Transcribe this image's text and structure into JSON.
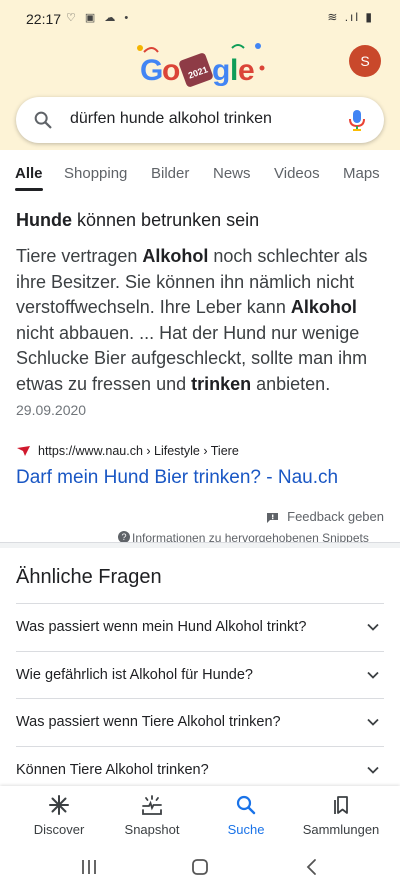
{
  "status_bar": {
    "time": "22:17",
    "left_icons": "♡ ▣ ☁ •",
    "right_icons": "≋ .ıl ▮"
  },
  "header": {
    "doodle_label": "Google",
    "doodle_year": "2021",
    "avatar_initial": "S",
    "avatar_color": "#c9482b"
  },
  "search": {
    "query": "dürfen hunde alkohol trinken"
  },
  "tabs": [
    "Alle",
    "Shopping",
    "Bilder",
    "News",
    "Videos",
    "Maps"
  ],
  "snippet": {
    "title_bold": "Hunde",
    "title_rest": " können betrunken sein",
    "body": [
      {
        "t": "Tiere vertragen ",
        "b": false
      },
      {
        "t": "Alkohol",
        "b": true
      },
      {
        "t": " noch schlechter als ihre Besitzer. Sie können ihn nämlich nicht verstoffwechseln. Ihre Leber kann ",
        "b": false
      },
      {
        "t": "Alkohol",
        "b": true
      },
      {
        "t": " nicht abbauen. ... Hat der Hund nur wenige Schlucke Bier aufgeschleckt, sollte man ihm etwas zu fressen und ",
        "b": false
      },
      {
        "t": "trinken",
        "b": true
      },
      {
        "t": " anbieten. ",
        "b": false
      }
    ],
    "date": "29.09.2020",
    "source_url": "https://www.nau.ch › Lifestyle › Tiere",
    "result_title": "Darf mein Hund Bier trinken? - Nau.ch",
    "feedback": "Feedback geben",
    "info": "Informationen zu hervorgehobenen Snippets"
  },
  "related": {
    "heading": "Ähnliche Fragen",
    "questions": [
      "Was passiert wenn mein Hund Alkohol trinkt?",
      "Wie gefährlich ist Alkohol für Hunde?",
      "Was passiert wenn Tiere Alkohol trinken?",
      "Können Tiere Alkohol trinken?"
    ]
  },
  "bottom_nav": {
    "discover": "Discover",
    "snapshot": "Snapshot",
    "search": "Suche",
    "collections": "Sammlungen"
  },
  "colors": {
    "link": "#1a57c4",
    "active_nav": "#1a73e8",
    "header_bg": "#fdf3d6"
  }
}
